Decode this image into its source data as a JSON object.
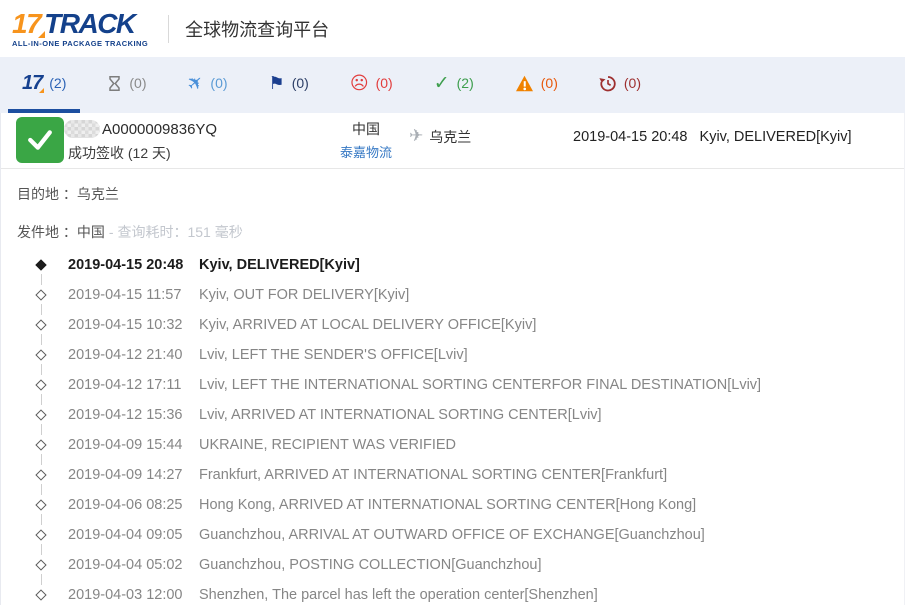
{
  "header": {
    "logo": {
      "part1": "17",
      "part2": "TRACK",
      "tagline": "ALL-IN-ONE PACKAGE TRACKING"
    },
    "title": "全球物流查询平台"
  },
  "tabs": [
    {
      "id": "all",
      "icon": "seventeen-logo-icon",
      "count": "(2)",
      "color": "#2b62b5",
      "active": true
    },
    {
      "id": "pending",
      "icon": "hourglass-icon",
      "count": "(0)",
      "color": "#8a8a8a",
      "active": false
    },
    {
      "id": "transit",
      "icon": "plane-icon",
      "count": "(0)",
      "color": "#5b9bd5",
      "active": false
    },
    {
      "id": "arrived",
      "icon": "flag-icon",
      "count": "(0)",
      "color": "#2c3e66",
      "active": false
    },
    {
      "id": "undelivered",
      "icon": "sad-face-icon",
      "count": "(0)",
      "color": "#e23d3d",
      "active": false
    },
    {
      "id": "delivered",
      "icon": "check-icon",
      "count": "(2)",
      "color": "#3d9e4d",
      "active": false
    },
    {
      "id": "exception",
      "icon": "warning-icon",
      "count": "(0)",
      "color": "#e8590c",
      "active": false
    },
    {
      "id": "expired",
      "icon": "history-icon",
      "count": "(0)",
      "color": "#9e2f2f",
      "active": false
    }
  ],
  "shipment": {
    "tracking_number_visible": "A0000009836YQ",
    "status_line": "成功签收 (12 天)",
    "origin": "中国",
    "carrier": "泰嘉物流",
    "destination": "乌克兰",
    "latest_time": "2019-04-15 20:48",
    "latest_status": "Kyiv, DELIVERED[Kyiv]",
    "status_color": "#3aa645"
  },
  "details": {
    "destination_label": "目的地 ：",
    "destination_value": "乌克兰",
    "origin_label": "发件地 ：",
    "origin_value": "中国",
    "query_time_note": "- 查询耗时：151 毫秒"
  },
  "timeline": [
    {
      "date": "2019-04-15 20:48",
      "status": "Kyiv, DELIVERED[Kyiv]",
      "current": true
    },
    {
      "date": "2019-04-15 11:57",
      "status": "Kyiv, OUT FOR DELIVERY[Kyiv]",
      "current": false
    },
    {
      "date": "2019-04-15 10:32",
      "status": "Kyiv, ARRIVED AT LOCAL DELIVERY OFFICE[Kyiv]",
      "current": false
    },
    {
      "date": "2019-04-12 21:40",
      "status": "Lviv, LEFT THE SENDER'S OFFICE[Lviv]",
      "current": false
    },
    {
      "date": "2019-04-12 17:11",
      "status": "Lviv, LEFT THE INTERNATIONAL SORTING CENTERFOR FINAL DESTINATION[Lviv]",
      "current": false
    },
    {
      "date": "2019-04-12 15:36",
      "status": "Lviv, ARRIVED AT INTERNATIONAL SORTING CENTER[Lviv]",
      "current": false
    },
    {
      "date": "2019-04-09 15:44",
      "status": "UKRAINE, RECIPIENT WAS VERIFIED",
      "current": false
    },
    {
      "date": "2019-04-09 14:27",
      "status": "Frankfurt, ARRIVED AT INTERNATIONAL SORTING CENTER[Frankfurt]",
      "current": false
    },
    {
      "date": "2019-04-06 08:25",
      "status": "Hong Kong, ARRIVED AT INTERNATIONAL SORTING CENTER[Hong Kong]",
      "current": false
    },
    {
      "date": "2019-04-04 09:05",
      "status": "Guanchzhou, ARRIVAL AT OUTWARD OFFICE OF EXCHANGE[Guanchzhou]",
      "current": false
    },
    {
      "date": "2019-04-04 05:02",
      "status": "Guanchzhou, POSTING COLLECTION[Guanchzhou]",
      "current": false
    },
    {
      "date": "2019-04-03 12:00",
      "status": "Shenzhen, The parcel has left the operation center[Shenzhen]",
      "current": false
    }
  ]
}
